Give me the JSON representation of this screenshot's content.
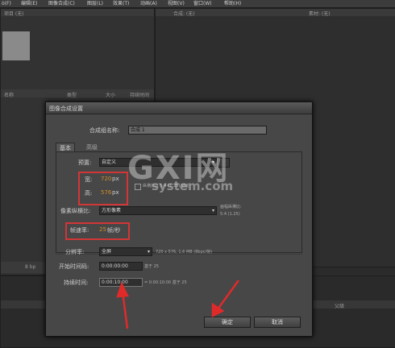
{
  "menubar": {
    "items": [
      "ὸ(F)",
      "编辑(E)",
      "图像合成(C)",
      "图层(L)",
      "效果(T)",
      "动画(A)",
      "视图(V)",
      "窗口(W)",
      "帮助(H)"
    ]
  },
  "project_panel": {
    "top_tab": "项目 (无)",
    "columns": [
      "名称",
      "类型",
      "大小",
      "持续时间"
    ],
    "bottom_bar": "8 bp"
  },
  "comp_viewer": {
    "tab1": "合成: (无)",
    "tab2": "素材: (无)"
  },
  "dialog": {
    "title": "图像合成设置",
    "comp_name_label": "合成组名称:",
    "comp_name_value": "合成 1",
    "tabs": [
      "基本",
      "高级"
    ],
    "preset_label": "预置:",
    "preset_value": "自定义",
    "width_label": "宽:",
    "width_value": "720",
    "width_unit": "px",
    "height_label": "高:",
    "height_value": "576",
    "height_unit": "px",
    "lock_aspect_label": "纵横比以 5:4 (1.25) 锁定",
    "pixel_aspect_label": "像素纵横比:",
    "pixel_aspect_value": "方形像素",
    "frame_aspect_label": "画幅纵横比:",
    "frame_aspect_value": "5:4 (1.25)",
    "framerate_label": "帧速率:",
    "framerate_value": "25",
    "framerate_unit": "帧/秒",
    "resolution_label": "分辨率:",
    "resolution_value": "全屏",
    "resolution_info": "720 x 576, 1.6 MB (8bpc/帧)",
    "start_tc_label": "开始时间码:",
    "start_tc_value": "0:00:00:00",
    "start_tc_note": "基于 25",
    "duration_label": "持续时间:",
    "duration_value": "0:00:10:00",
    "duration_note": "= 0:00:10:00  基于 25",
    "ok_label": "确定",
    "cancel_label": "取消"
  },
  "timeline": {
    "bottom_label": "父级"
  },
  "watermark": {
    "big": "GXI网",
    "small": "system.com"
  }
}
